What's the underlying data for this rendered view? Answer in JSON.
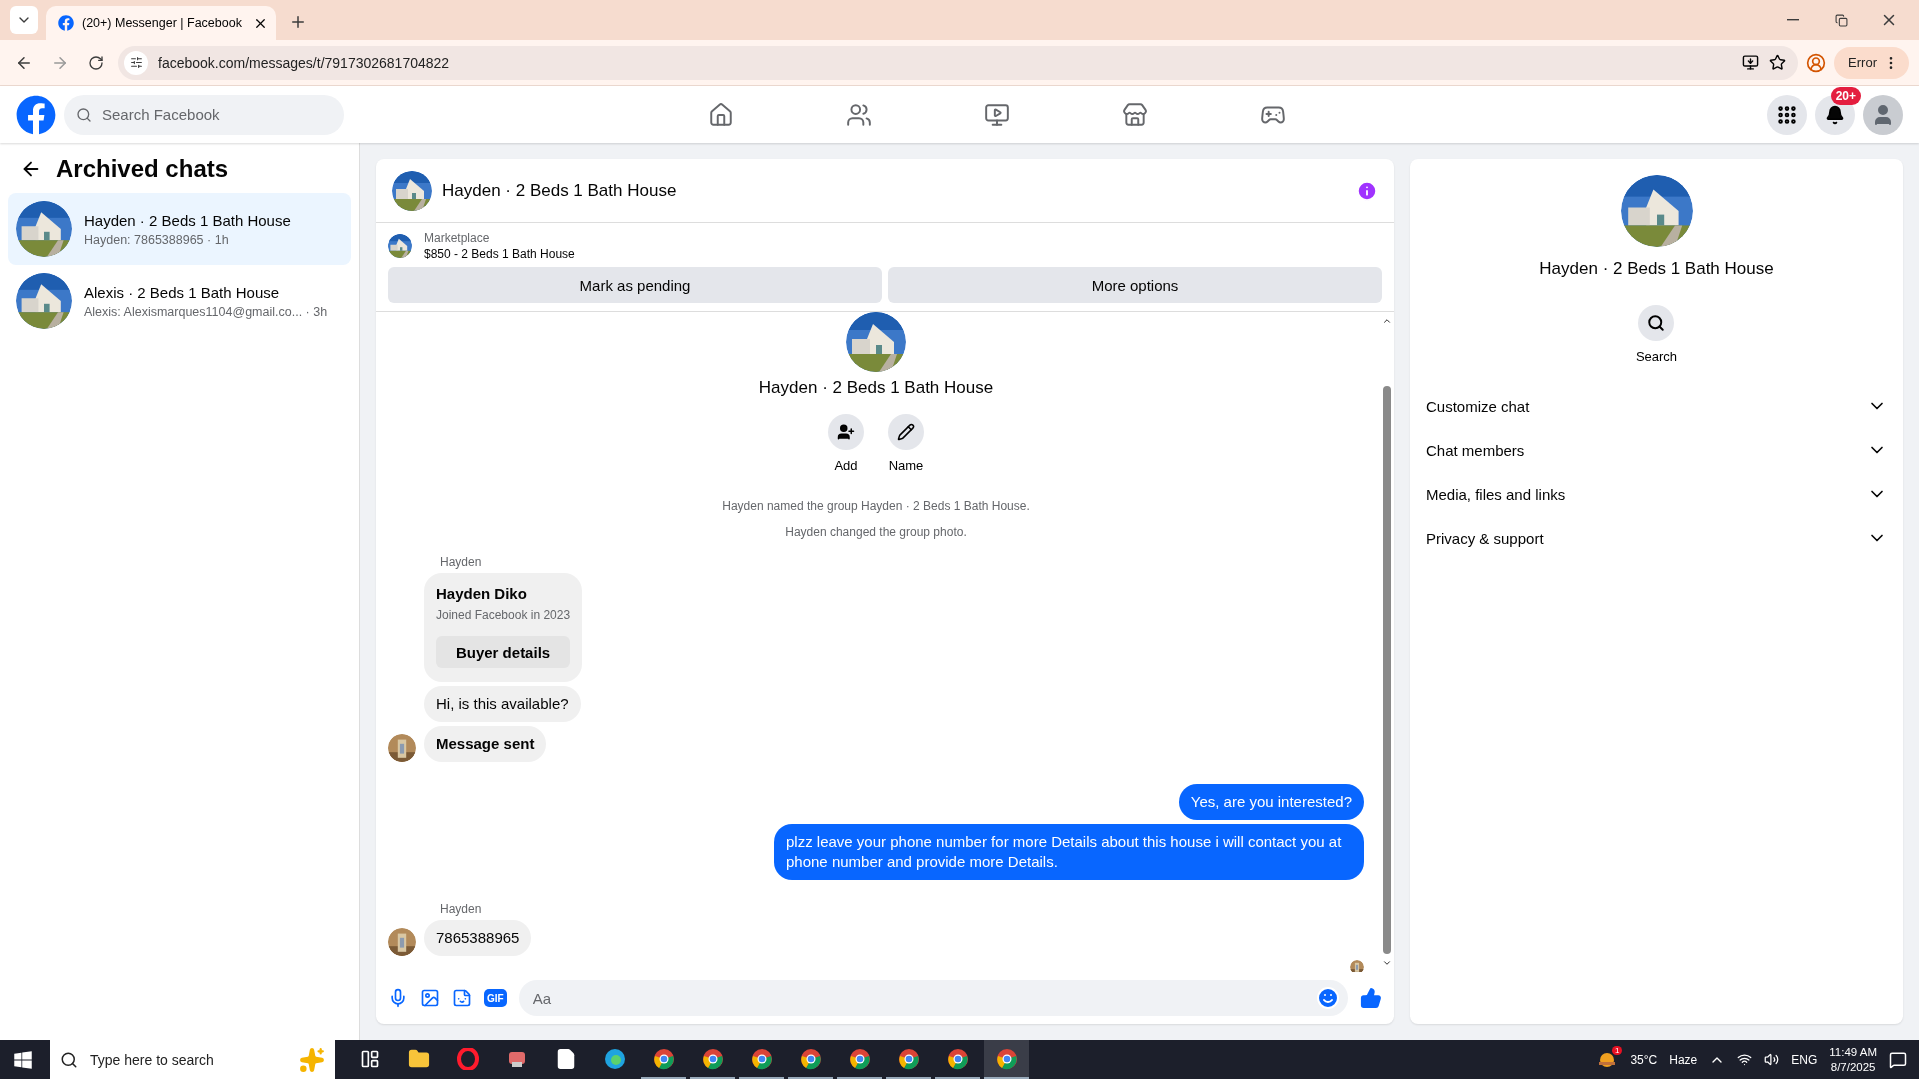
{
  "browser": {
    "tab_title": "(20+) Messenger | Facebook",
    "url": "facebook.com/messages/t/7917302681704822",
    "profile_button": "Error"
  },
  "header": {
    "search": {
      "placeholder": "Search Facebook"
    },
    "nav": [
      {
        "kind": "home"
      },
      {
        "kind": "friends"
      },
      {
        "kind": "video"
      },
      {
        "kind": "marketplace"
      },
      {
        "kind": "gaming"
      }
    ],
    "notification_badge": "20+"
  },
  "sidebar": {
    "title": "Archived chats",
    "chats": [
      {
        "name": "Hayden · 2 Beds 1 Bath House",
        "preview": "Hayden: 7865388965",
        "time": "· 1h",
        "selected": true
      },
      {
        "name": "Alexis · 2 Beds 1 Bath House",
        "preview": "Alexis: Alexismarques1104@gmail.co...",
        "time": "· 3h",
        "selected": false
      }
    ]
  },
  "chat": {
    "title": "Hayden · 2 Beds 1 Bath House",
    "listing": {
      "label": "Marketplace",
      "title": "$850 - 2 Beds 1 Bath House"
    },
    "actions": [
      "Mark as pending",
      "More options"
    ],
    "group": {
      "name": "Hayden · 2 Beds 1 Bath House",
      "actions": [
        {
          "kind": "add",
          "label": "Add"
        },
        {
          "kind": "name",
          "label": "Name"
        }
      ]
    },
    "events": [
      "Hayden named the group Hayden · 2 Beds 1 Bath House.",
      "Hayden changed the group photo."
    ],
    "messages": [
      {
        "kind": "sender",
        "text": "Hayden"
      },
      {
        "kind": "card",
        "title": "Hayden Diko",
        "subtitle": "Joined Facebook in 2023",
        "button": "Buyer details"
      },
      {
        "kind": "incoming",
        "text": "Hi, is this available?",
        "avatar": false
      },
      {
        "kind": "notice",
        "text": "Message sent",
        "avatar": true
      },
      {
        "kind": "outgoing",
        "text": "Yes, are you interested?"
      },
      {
        "kind": "outgoing",
        "text": "plzz leave your phone number for more Details about this house i will contact you at phone number and provide more Details."
      },
      {
        "kind": "sender",
        "text": "Hayden"
      },
      {
        "kind": "incoming",
        "text": "7865388965",
        "avatar": true
      }
    ],
    "composer": {
      "placeholder": "Aa",
      "gif": "GIF"
    }
  },
  "details": {
    "name": "Hayden · 2 Beds 1 Bath House",
    "search": "Search",
    "sections": [
      "Customize chat",
      "Chat members",
      "Media, files and links",
      "Privacy & support"
    ]
  },
  "taskbar": {
    "search": {
      "placeholder": "Type here to search"
    },
    "weather_badge": "1",
    "temperature": "35°C",
    "weather": "Haze",
    "language": "ENG",
    "time": "11:49 AM",
    "date": "8/7/2025"
  }
}
